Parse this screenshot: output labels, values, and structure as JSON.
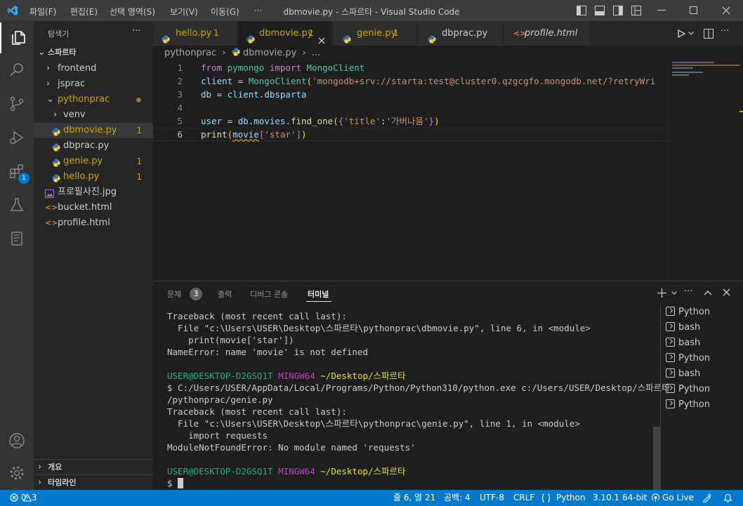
{
  "titlebar": {
    "menus": [
      "파일(F)",
      "편집(E)",
      "선택 영역(S)",
      "보기(V)",
      "이동(G)",
      "···"
    ],
    "title": "dbmovie.py - 스파르타 - Visual Studio Code"
  },
  "activity": {
    "extensions_badge": "1"
  },
  "sidebar": {
    "header": "탐색기",
    "more": "···",
    "root": "스파르타",
    "items": [
      {
        "label": "frontend",
        "count": ""
      },
      {
        "label": "jsprac",
        "count": ""
      },
      {
        "label": "pythonprac",
        "count": ""
      },
      {
        "label": "venv",
        "count": ""
      },
      {
        "label": "dbmovie.py",
        "count": "1"
      },
      {
        "label": "dbprac.py",
        "count": ""
      },
      {
        "label": "genie.py",
        "count": "1"
      },
      {
        "label": "hello.py",
        "count": "1"
      },
      {
        "label": "프로필사진.jpg",
        "count": ""
      },
      {
        "label": "bucket.html",
        "count": ""
      },
      {
        "label": "profile.html",
        "count": ""
      }
    ],
    "outline": "개요",
    "timeline": "타임라인"
  },
  "tabs": [
    {
      "label": "hello.py",
      "count": "1"
    },
    {
      "label": "dbmovie.py",
      "count": "1"
    },
    {
      "label": "genie.py",
      "count": "1"
    },
    {
      "label": "dbprac.py",
      "count": ""
    },
    {
      "label": "profile.html",
      "count": ""
    }
  ],
  "breadcrumb": {
    "folder": "pythonprac",
    "file": "dbmovie.py",
    "tail": "..."
  },
  "editor": {
    "line_numbers": [
      "1",
      "2",
      "3",
      "4",
      "5",
      "6"
    ],
    "l1": {
      "kw1": "from",
      "mod": "pymongo",
      "kw2": "import",
      "cls": "MongoClient"
    },
    "l2": {
      "var": "client",
      "eq": " = ",
      "cls": "MongoClient",
      "p1": "(",
      "str": "'mongodb+srv://starta:test@cluster0.qzgcgfo.mongodb.net/?retryWri"
    },
    "l3": {
      "var": "db",
      "eq": " = ",
      "obj": "client",
      "dot": ".",
      "attr": "dbsparta"
    },
    "l5": {
      "var": "user",
      "eq": " = ",
      "obj": "db",
      "dot1": ".",
      "attr": "movies",
      "dot2": ".",
      "fn": "find_one",
      "p1": "(",
      "b1": "{",
      "k": "'title'",
      "colon": ":",
      "v": "'가버나움'",
      "b2": "}",
      "p2": ")"
    },
    "l6": {
      "fn": "print",
      "p1": "(",
      "arg": "movie",
      "b1": "[",
      "k": "'star'",
      "b2": "]",
      "p2": ")"
    }
  },
  "panel": {
    "tabs": [
      "문제",
      "출력",
      "디버그 콘솔",
      "터미널"
    ],
    "problems_count": "3",
    "terminal": {
      "t1": "Traceback (most recent call last):",
      "t2": "  File \"c:\\Users\\USER\\Desktop\\스파르타\\pythonprac\\dbmovie.py\", line 6, in <module>",
      "t3": "    print(movie['star'])",
      "t4": "NameError: name 'movie' is not defined",
      "user": "USER@DESKTOP-D2GSQ1T",
      "mingw": "MINGW64",
      "path": "~/Desktop/스파르타",
      "cmd1": "$ C:/Users/USER/AppData/Local/Programs/Python/Python310/python.exe c:/Users/USER/Desktop/스파르타",
      "cmd2": "/pythonprac/genie.py",
      "t5": "Traceback (most recent call last):",
      "t6": "  File \"c:\\Users\\USER\\Desktop\\스파르타\\pythonprac\\genie.py\", line 1, in <module>",
      "t7": "    import requests",
      "t8": "ModuleNotFoundError: No module named 'requests'",
      "prompt": "$"
    },
    "terminal_list": [
      "Python",
      "bash",
      "bash",
      "Python",
      "bash",
      "Python",
      "Python"
    ]
  },
  "status": {
    "errors": "0",
    "warnings": "3",
    "position": "줄 6, 열 21",
    "spaces": "공백: 4",
    "encoding": "UTF-8",
    "eol": "CRLF",
    "language": "Python",
    "interpreter": "3.10.1 64-bit",
    "golive": "Go Live"
  }
}
